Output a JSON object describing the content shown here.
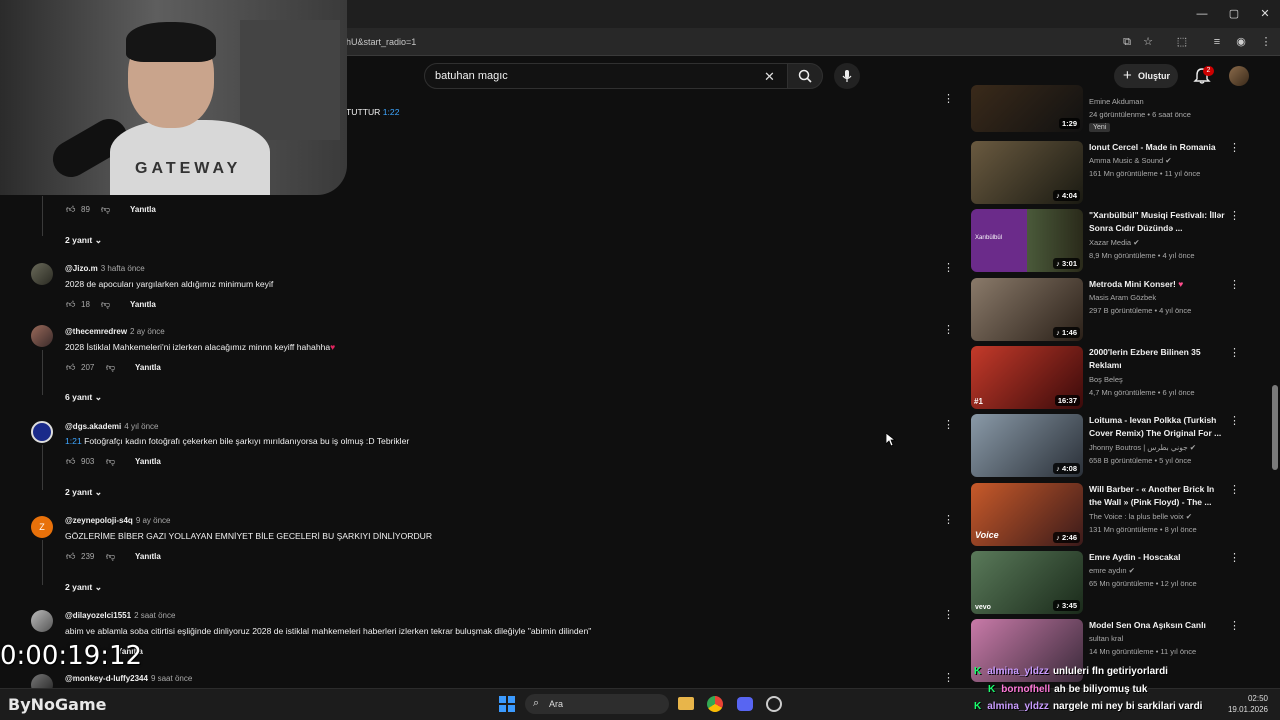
{
  "browser": {
    "url_fragment": "hU&start_radio=1"
  },
  "header": {
    "search_value": "batuhan magıc",
    "create_label": "Oluştur",
    "notification_count": "2"
  },
  "webcam": {
    "shirt_text": "GATEWAY"
  },
  "comments": [
    {
      "partial_text": "TUTTUR",
      "timestamp": "1:22"
    },
    {
      "likes": "89",
      "reply_label": "Yanıtla",
      "replies_label": "2 yanıt"
    },
    {
      "handle": "@Jizo.m",
      "time": "3 hafta önce",
      "text": "2028 de apocuları yargılarken aldığımız minimum keyif",
      "likes": "18",
      "reply_label": "Yanıtla"
    },
    {
      "handle": "@thecemredrew",
      "time": "2 ay önce",
      "text": "2028 İstiklal Mahkemeleri'ni izlerken alacağımız minnn keyiff hahahha",
      "likes": "207",
      "reply_label": "Yanıtla",
      "replies_label": "6 yanıt"
    },
    {
      "handle": "@dgs.akademi",
      "time": "4 yıl önce",
      "timestamp": "1:21",
      "text": " Fotoğrafçı kadın fotoğrafı çekerken bile şarkıyı mırıldanıyorsa bu iş olmuş :D Tebrikler",
      "likes": "903",
      "reply_label": "Yanıtla",
      "replies_label": "2 yanıt"
    },
    {
      "handle": "@zeynepoloji-s4q",
      "time": "9 ay önce",
      "text": "GÖZLERİME BİBER GAZI YOLLAYAN EMNİYET BİLE GECELERİ BU ŞARKIYI DİNLİYORDUR",
      "likes": "239",
      "reply_label": "Yanıtla",
      "replies_label": "2 yanıt",
      "avatar_letter": "Z"
    },
    {
      "handle": "@dilayozelci1551",
      "time": "2 saat önce",
      "text": "abim ve ablamla soba citirtisi eşliğinde dinliyoruz 2028 de istiklal mahkemeleri haberleri izlerken tekrar buluşmak dileğiyle \"abimin dilinden\"",
      "reply_label": "Yanıtla"
    },
    {
      "handle": "@monkey-d-luffy2344",
      "time": "9 saat önce"
    }
  ],
  "sidebar": [
    {
      "title": "",
      "channel": "Emine Akduman",
      "meta": "24 görüntülenme • 6 saat önce",
      "badge": "Yeni",
      "duration": "1:29"
    },
    {
      "title": "Ionut Cercel - Made in Romania",
      "channel": "Amma Music & Sound",
      "meta": "161 Mn görüntüleme • 11 yıl önce",
      "duration": "4:04"
    },
    {
      "title": "\"Xarıbülbül\" Musiqi Festivalı: İllər Sonra Cıdır Düzündə ...",
      "channel": "Xazar Media",
      "meta": "8,9 Mn görüntüleme • 4 yıl önce",
      "duration": "3:01",
      "thumb_text": "Xarıbülbül"
    },
    {
      "title": "Metroda Mini Konser!",
      "channel": "Masis Aram Gözbek",
      "meta": "297 B görüntüleme • 4 yıl önce",
      "duration": "1:46"
    },
    {
      "title": "2000'lerin Ezbere Bilinen 35 Reklamı",
      "channel": "Boş Beleş",
      "meta": "4,7 Mn görüntüleme • 6 yıl önce",
      "duration": "16:37",
      "rank": "#1"
    },
    {
      "title": "Loituma - Ievan Polkka (Turkish Cover Remix) The Original For ...",
      "channel": "Jhonny Boutros | جوني بطرس",
      "meta": "658 B görüntüleme • 5 yıl önce",
      "duration": "4:08"
    },
    {
      "title": "Will Barber - « Another Brick In the Wall » (Pink Floyd) - The ...",
      "channel": "The Voice : la plus belle voix",
      "meta": "131 Mn görüntüleme • 8 yıl önce",
      "duration": "2:46",
      "thumb_text": "Voice"
    },
    {
      "title": "Emre Aydin - Hoscakal",
      "channel": "emre aydın",
      "meta": "65 Mn görüntüleme • 12 yıl önce",
      "duration": "3:45",
      "thumb_text": "vevo"
    },
    {
      "title": "Model  Sen Ona Aşıksın Canlı",
      "channel": "sultan kral",
      "meta": "14 Mn görüntüleme • 11 yıl önce"
    }
  ],
  "overlay": {
    "timer": "0:00:19:12",
    "brand": "ByNoGame",
    "chat": [
      {
        "user": "almina_yldzz",
        "msg": "unluleri fln getiriyorlardi"
      },
      {
        "user": "bornofhell",
        "msg": "ah be biliyomuş tuk"
      },
      {
        "user": "almina_yldzz",
        "msg": "nargele mi ney bi sarkilari vardi"
      }
    ]
  },
  "taskbar": {
    "search_label": "Ara",
    "time": "02:50",
    "date": "19.01.2026"
  },
  "colors": {
    "background": "#0f0f0f",
    "link": "#3ea6ff",
    "chat_badge": "#1aff6e",
    "notification": "#cc0000"
  }
}
